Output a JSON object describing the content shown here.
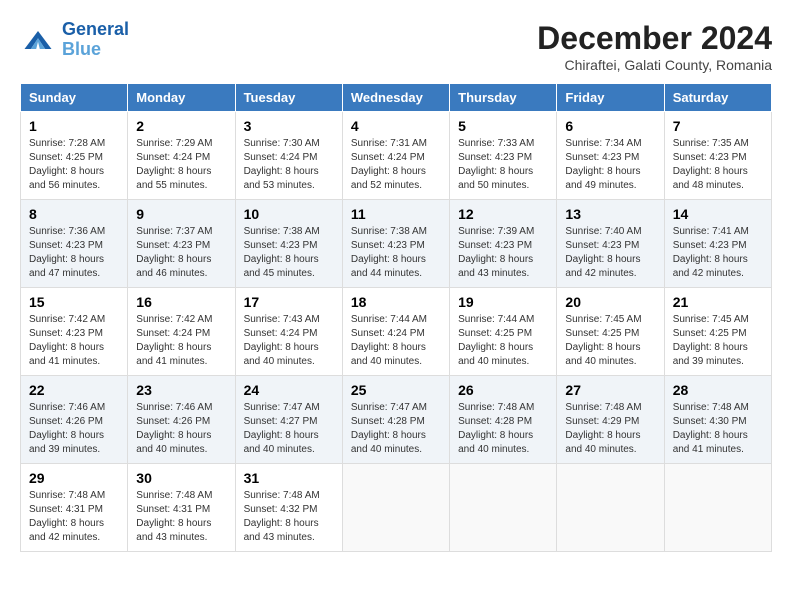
{
  "header": {
    "logo": {
      "line1": "General",
      "line2": "Blue"
    },
    "title": "December 2024",
    "subtitle": "Chiraftei, Galati County, Romania"
  },
  "days_of_week": [
    "Sunday",
    "Monday",
    "Tuesday",
    "Wednesday",
    "Thursday",
    "Friday",
    "Saturday"
  ],
  "weeks": [
    [
      {
        "day": "1",
        "sunrise": "7:28 AM",
        "sunset": "4:25 PM",
        "daylight": "8 hours and 56 minutes."
      },
      {
        "day": "2",
        "sunrise": "7:29 AM",
        "sunset": "4:24 PM",
        "daylight": "8 hours and 55 minutes."
      },
      {
        "day": "3",
        "sunrise": "7:30 AM",
        "sunset": "4:24 PM",
        "daylight": "8 hours and 53 minutes."
      },
      {
        "day": "4",
        "sunrise": "7:31 AM",
        "sunset": "4:24 PM",
        "daylight": "8 hours and 52 minutes."
      },
      {
        "day": "5",
        "sunrise": "7:33 AM",
        "sunset": "4:23 PM",
        "daylight": "8 hours and 50 minutes."
      },
      {
        "day": "6",
        "sunrise": "7:34 AM",
        "sunset": "4:23 PM",
        "daylight": "8 hours and 49 minutes."
      },
      {
        "day": "7",
        "sunrise": "7:35 AM",
        "sunset": "4:23 PM",
        "daylight": "8 hours and 48 minutes."
      }
    ],
    [
      {
        "day": "8",
        "sunrise": "7:36 AM",
        "sunset": "4:23 PM",
        "daylight": "8 hours and 47 minutes."
      },
      {
        "day": "9",
        "sunrise": "7:37 AM",
        "sunset": "4:23 PM",
        "daylight": "8 hours and 46 minutes."
      },
      {
        "day": "10",
        "sunrise": "7:38 AM",
        "sunset": "4:23 PM",
        "daylight": "8 hours and 45 minutes."
      },
      {
        "day": "11",
        "sunrise": "7:38 AM",
        "sunset": "4:23 PM",
        "daylight": "8 hours and 44 minutes."
      },
      {
        "day": "12",
        "sunrise": "7:39 AM",
        "sunset": "4:23 PM",
        "daylight": "8 hours and 43 minutes."
      },
      {
        "day": "13",
        "sunrise": "7:40 AM",
        "sunset": "4:23 PM",
        "daylight": "8 hours and 42 minutes."
      },
      {
        "day": "14",
        "sunrise": "7:41 AM",
        "sunset": "4:23 PM",
        "daylight": "8 hours and 42 minutes."
      }
    ],
    [
      {
        "day": "15",
        "sunrise": "7:42 AM",
        "sunset": "4:23 PM",
        "daylight": "8 hours and 41 minutes."
      },
      {
        "day": "16",
        "sunrise": "7:42 AM",
        "sunset": "4:24 PM",
        "daylight": "8 hours and 41 minutes."
      },
      {
        "day": "17",
        "sunrise": "7:43 AM",
        "sunset": "4:24 PM",
        "daylight": "8 hours and 40 minutes."
      },
      {
        "day": "18",
        "sunrise": "7:44 AM",
        "sunset": "4:24 PM",
        "daylight": "8 hours and 40 minutes."
      },
      {
        "day": "19",
        "sunrise": "7:44 AM",
        "sunset": "4:25 PM",
        "daylight": "8 hours and 40 minutes."
      },
      {
        "day": "20",
        "sunrise": "7:45 AM",
        "sunset": "4:25 PM",
        "daylight": "8 hours and 40 minutes."
      },
      {
        "day": "21",
        "sunrise": "7:45 AM",
        "sunset": "4:25 PM",
        "daylight": "8 hours and 39 minutes."
      }
    ],
    [
      {
        "day": "22",
        "sunrise": "7:46 AM",
        "sunset": "4:26 PM",
        "daylight": "8 hours and 39 minutes."
      },
      {
        "day": "23",
        "sunrise": "7:46 AM",
        "sunset": "4:26 PM",
        "daylight": "8 hours and 40 minutes."
      },
      {
        "day": "24",
        "sunrise": "7:47 AM",
        "sunset": "4:27 PM",
        "daylight": "8 hours and 40 minutes."
      },
      {
        "day": "25",
        "sunrise": "7:47 AM",
        "sunset": "4:28 PM",
        "daylight": "8 hours and 40 minutes."
      },
      {
        "day": "26",
        "sunrise": "7:48 AM",
        "sunset": "4:28 PM",
        "daylight": "8 hours and 40 minutes."
      },
      {
        "day": "27",
        "sunrise": "7:48 AM",
        "sunset": "4:29 PM",
        "daylight": "8 hours and 40 minutes."
      },
      {
        "day": "28",
        "sunrise": "7:48 AM",
        "sunset": "4:30 PM",
        "daylight": "8 hours and 41 minutes."
      }
    ],
    [
      {
        "day": "29",
        "sunrise": "7:48 AM",
        "sunset": "4:31 PM",
        "daylight": "8 hours and 42 minutes."
      },
      {
        "day": "30",
        "sunrise": "7:48 AM",
        "sunset": "4:31 PM",
        "daylight": "8 hours and 43 minutes."
      },
      {
        "day": "31",
        "sunrise": "7:48 AM",
        "sunset": "4:32 PM",
        "daylight": "8 hours and 43 minutes."
      },
      null,
      null,
      null,
      null
    ]
  ]
}
